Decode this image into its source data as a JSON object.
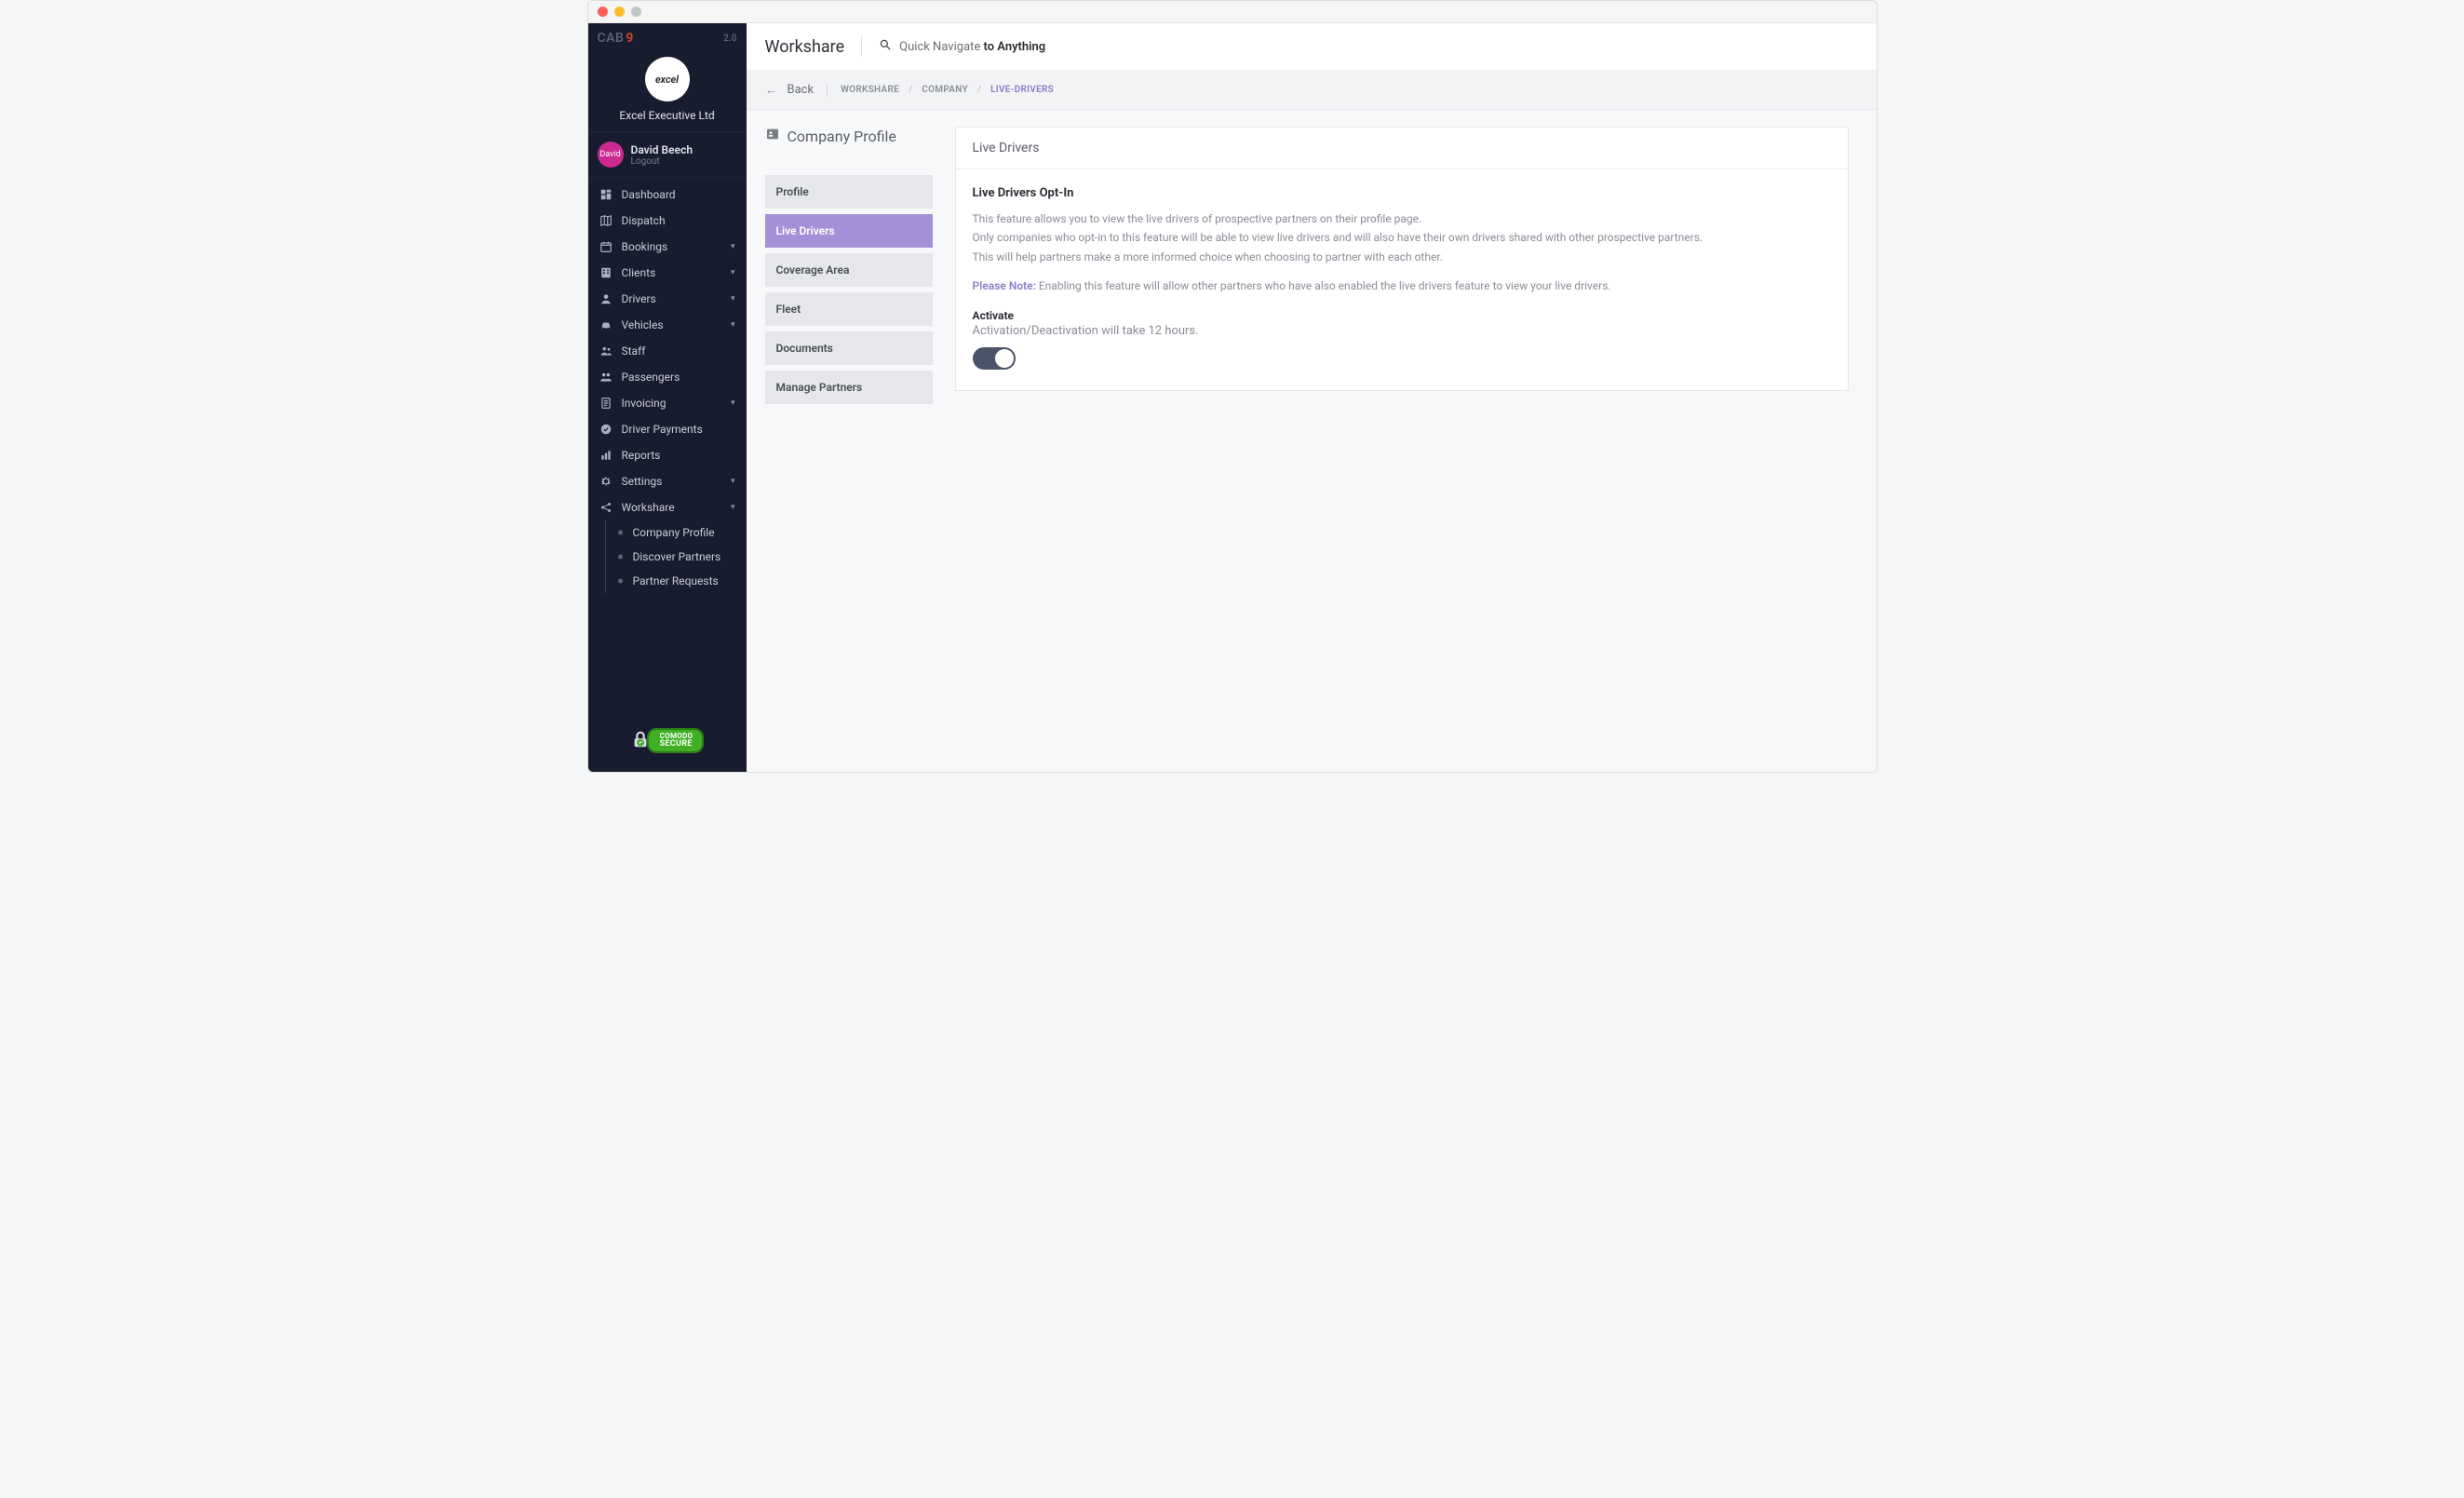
{
  "brand": {
    "name": "CAB",
    "accent": "9",
    "version": "2.0"
  },
  "company": {
    "logo_text": "excel",
    "name": "Excel Executive Ltd"
  },
  "user": {
    "avatar_text": "David",
    "name": "David Beech",
    "logout": "Logout"
  },
  "nav": {
    "items": [
      {
        "label": "Dashboard",
        "icon": "dashboard-icon",
        "expandable": false
      },
      {
        "label": "Dispatch",
        "icon": "map-icon",
        "expandable": false
      },
      {
        "label": "Bookings",
        "icon": "calendar-icon",
        "expandable": true
      },
      {
        "label": "Clients",
        "icon": "building-icon",
        "expandable": true
      },
      {
        "label": "Drivers",
        "icon": "user-icon",
        "expandable": true
      },
      {
        "label": "Vehicles",
        "icon": "car-icon",
        "expandable": true
      },
      {
        "label": "Staff",
        "icon": "people-icon",
        "expandable": false
      },
      {
        "label": "Passengers",
        "icon": "group-icon",
        "expandable": false
      },
      {
        "label": "Invoicing",
        "icon": "document-icon",
        "expandable": true
      },
      {
        "label": "Driver Payments",
        "icon": "check-icon",
        "expandable": false
      },
      {
        "label": "Reports",
        "icon": "chart-icon",
        "expandable": false
      },
      {
        "label": "Settings",
        "icon": "gear-icon",
        "expandable": true
      },
      {
        "label": "Workshare",
        "icon": "share-icon",
        "expandable": true,
        "children": [
          {
            "label": "Company Profile"
          },
          {
            "label": "Discover Partners"
          },
          {
            "label": "Partner Requests"
          }
        ]
      }
    ]
  },
  "secure_badge": {
    "line1": "COMODO",
    "line2": "SECURE"
  },
  "topbar": {
    "title": "Workshare",
    "search_prefix": "Quick Navigate ",
    "search_strong": "to Anything"
  },
  "pathbar": {
    "back": "Back",
    "crumbs": [
      "WORKSHARE",
      "COMPANY",
      "LIVE-DRIVERS"
    ]
  },
  "section": {
    "title": "Company Profile"
  },
  "vtabs": [
    {
      "label": "Profile"
    },
    {
      "label": "Live Drivers",
      "active": true
    },
    {
      "label": "Coverage Area"
    },
    {
      "label": "Fleet"
    },
    {
      "label": "Documents"
    },
    {
      "label": "Manage Partners"
    }
  ],
  "card": {
    "title": "Live Drivers",
    "h6": "Live Drivers Opt-In",
    "p1": "This feature allows you to view the live drivers of prospective partners on their profile page.",
    "p2": "Only companies who opt-in to this feature will be able to view live drivers and will also have their own drivers shared with other prospective partners.",
    "p3": "This will help partners make a more informed choice when choosing to partner with each other.",
    "note_label": "Please Note:",
    "note_text": " Enabling this feature will allow other partners who have also enabled the live drivers feature to view your live drivers.",
    "activate_label": "Activate",
    "activate_sub": "Activation/Deactivation will take 12 hours.",
    "toggle_on": true
  }
}
